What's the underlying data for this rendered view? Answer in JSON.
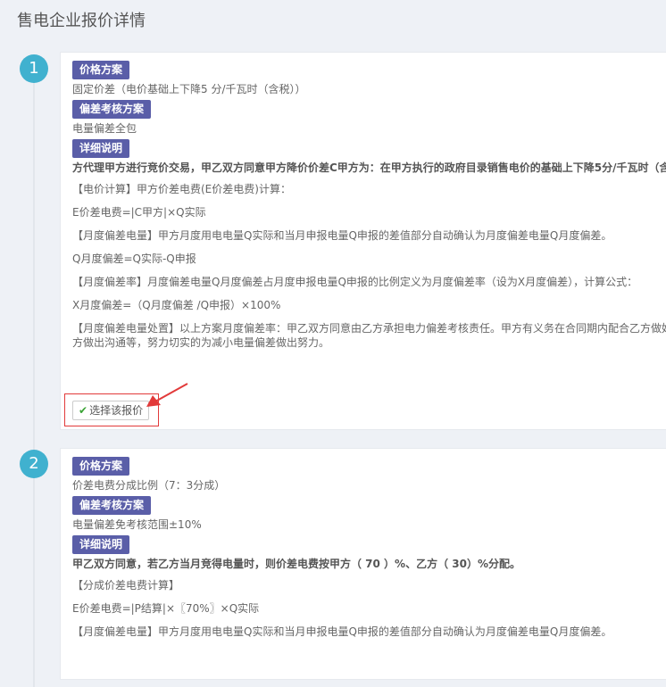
{
  "page": {
    "title": "售电企业报价详情"
  },
  "quotes": [
    {
      "number": "1",
      "price_label": "价格方案",
      "price_value": "固定价差（电价基础上下降5 分/千瓦时（含税））",
      "deviation_label": "偏差考核方案",
      "deviation_value": "电量偏差全包",
      "detail_label": "详细说明",
      "details": [
        "方代理甲方进行竞价交易，甲乙双方同意甲方降价价差C甲方为：在甲方执行的政府目录销售电价的基础上下降5分/千瓦时（含",
        "【电价计算】甲方价差电费(E价差电费)计算：",
        "E价差电费=|C甲方|×Q实际",
        "【月度偏差电量】甲方月度用电电量Q实际和当月申报电量Q申报的差值部分自动确认为月度偏差电量Q月度偏差。",
        "Q月度偏差=Q实际-Q申报",
        "【月度偏差率】月度偏差电量Q月度偏差占月度申报电量Q申报的比例定义为月度偏差率（设为X月度偏差），计算公式：",
        "X月度偏差=（Q月度偏差 /Q申报）×100%",
        "【月度偏差电量处置】以上方案月度偏差率：甲乙双方同意由乙方承担电力偏差考核责任。甲方有义务在合同期内配合乙方做好",
        "方做出沟通等，努力切实的为减小电量偏差做出努力。"
      ],
      "select_label": "选择该报价"
    },
    {
      "number": "2",
      "price_label": "价格方案",
      "price_value": "价差电费分成比例（7：3分成）",
      "deviation_label": "偏差考核方案",
      "deviation_value": "电量偏差免考核范围±10%",
      "detail_label": "详细说明",
      "details": [
        "甲乙双方同意，若乙方当月竞得电量时，则价差电费按甲方（ 70 ）%、乙方（ 30）%分配。",
        "【分成价差电费计算】",
        "E价差电费=|P结算|×〖70%〗×Q实际",
        "【月度偏差电量】甲方月度用电电量Q实际和当月申报电量Q申报的差值部分自动确认为月度偏差电量Q月度偏差。"
      ]
    }
  ],
  "icons": {
    "select": "check-icon",
    "pointer": "red-arrow-icon"
  },
  "colors": {
    "badge": "#40b1cf",
    "tag": "#5a5ea8",
    "highlight": "#e23a3a",
    "check": "#3aa335"
  }
}
